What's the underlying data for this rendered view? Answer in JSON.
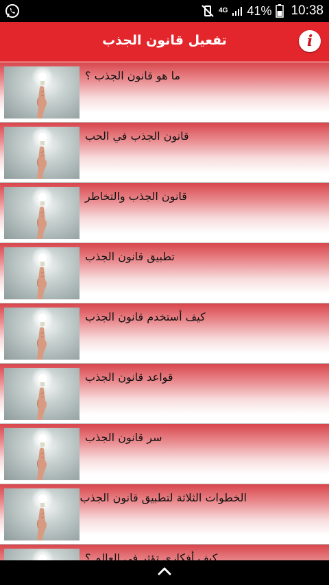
{
  "status_bar": {
    "left_icon": "whatsapp-icon",
    "network": "4G",
    "battery": "41%",
    "time": "10:38"
  },
  "app_bar": {
    "title": "تفعيل قانون الجذب",
    "info_glyph": "i",
    "accent_color": "#e3262c"
  },
  "items": [
    {
      "label": "ما هو قانون الجذب ؟"
    },
    {
      "label": "قانون الجذب في الحب"
    },
    {
      "label": "قانون الجذب والتخاطر"
    },
    {
      "label": "تطبيق قانون الجذب"
    },
    {
      "label": "كيف أستخدم قانون الجذب"
    },
    {
      "label": "قواعد قانون الجذب"
    },
    {
      "label": "سر قانون الجذب"
    },
    {
      "label": "الخطوات الثلاثة لتطبيق قانون الجذب"
    },
    {
      "label": "كيف أفكاري تؤثر في العالم ؟"
    }
  ],
  "bottom_bar": {
    "icon": "chevron-up-icon"
  }
}
